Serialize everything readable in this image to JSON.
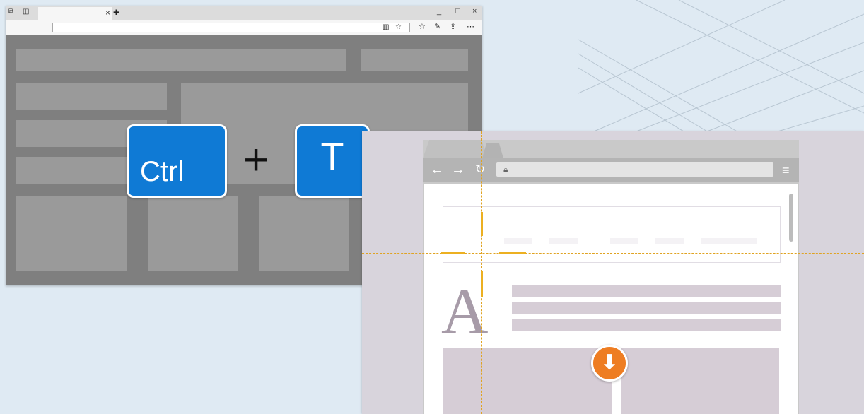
{
  "edge_browser": {
    "tab_close_glyph": "×",
    "new_tab_glyph": "+",
    "window_controls": [
      "_",
      "□",
      "×"
    ],
    "toolbar_icons": [
      "reading-view-icon",
      "favorite-star-icon",
      "favorites-hub-icon",
      "notes-pen-icon",
      "share-icon",
      "more-icon"
    ]
  },
  "shortcut": {
    "key1": "Ctrl",
    "plus": "+",
    "key2": "T"
  },
  "chrome_browser": {
    "page_letter": "A",
    "icons": [
      "back-arrow-icon",
      "forward-arrow-icon",
      "reload-icon",
      "lock-icon",
      "menu-icon"
    ]
  },
  "download_button": {
    "icon": "download-arrow-icon",
    "color": "#ee7d22"
  },
  "colors": {
    "key_blue": "#0f7ad5",
    "guide_orange": "#e0a321",
    "background": "#dfeaf3"
  }
}
